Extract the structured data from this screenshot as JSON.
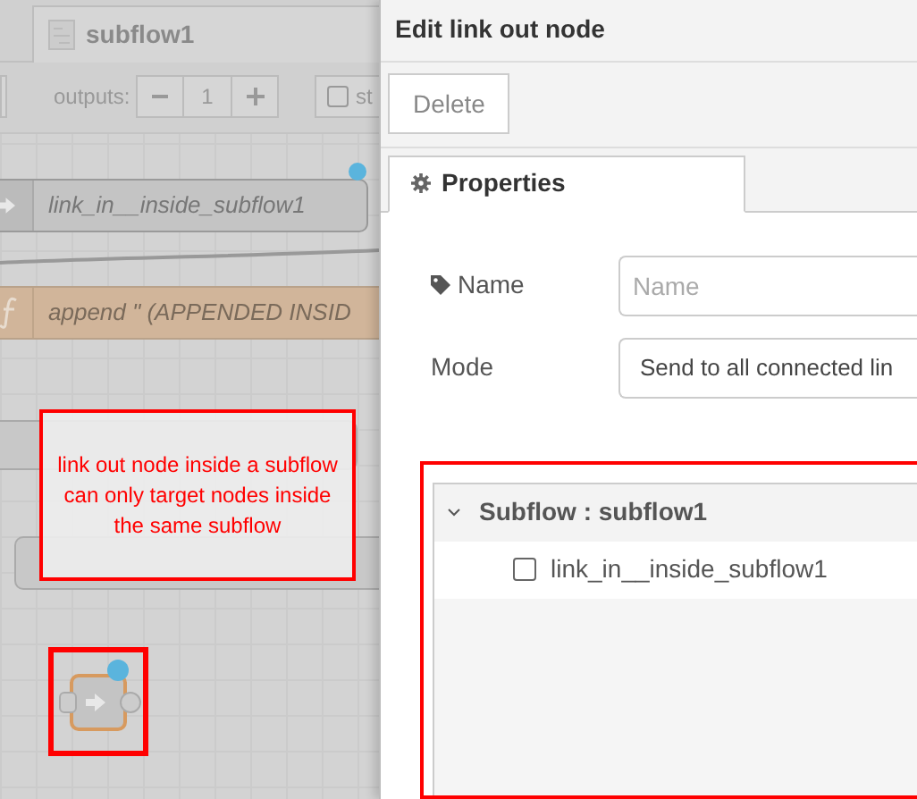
{
  "canvas": {
    "tab": {
      "label": "subflow1"
    },
    "outputs": {
      "label": "outputs:",
      "value": "1"
    },
    "status_checkbox": {
      "label": "st",
      "checked": false
    },
    "nodes": [
      {
        "kind": "link-in",
        "label": "link_in__inside_subflow1"
      },
      {
        "kind": "function",
        "label": "append \" (APPENDED INSID"
      }
    ],
    "annotation": "link out node inside a subflow can only target nodes inside the same subflow"
  },
  "dialog": {
    "title": "Edit link out node",
    "buttons": [
      "Delete"
    ],
    "tabs": [
      {
        "label": "Properties",
        "selected": true
      }
    ],
    "fields": [
      {
        "kind": "input",
        "label": "Name",
        "placeholder": "Name"
      },
      {
        "kind": "select",
        "label": "Mode",
        "value": "Send to all connected lin"
      }
    ],
    "tree": [
      {
        "label": "Subflow : subflow1",
        "expanded": true,
        "children": [
          {
            "label": "link_in__inside_subflow1",
            "checked": false
          }
        ]
      }
    ]
  }
}
